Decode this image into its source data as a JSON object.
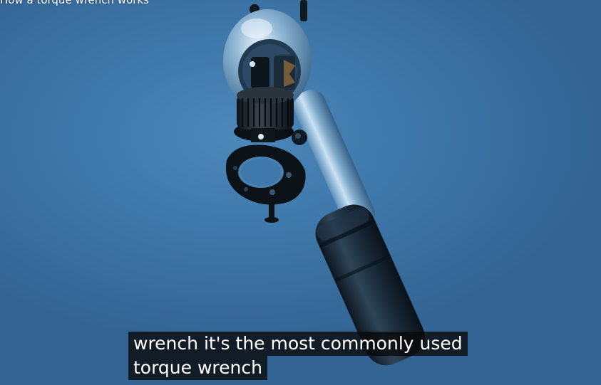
{
  "video": {
    "title": "How a torque wrench works"
  },
  "captions": {
    "line1": "wrench it's the most commonly used",
    "line2": "torque wrench"
  },
  "colors": {
    "background": "#3d76a8",
    "caption_bg": "#080808",
    "caption_text": "#ffffff"
  }
}
